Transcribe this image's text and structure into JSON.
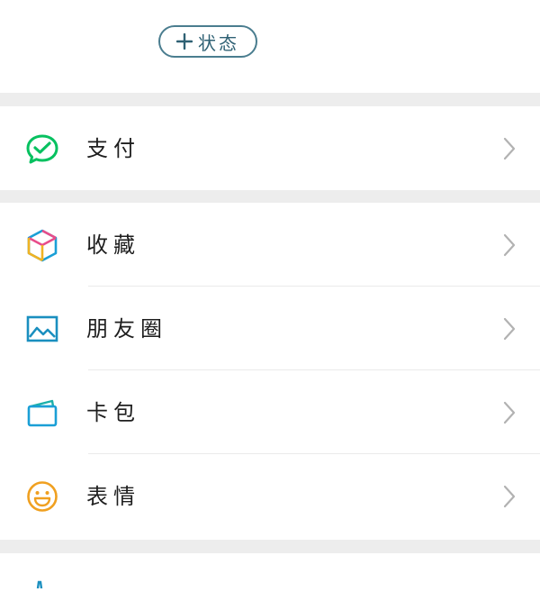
{
  "status_button": {
    "label": "状态",
    "icon": "plus-icon"
  },
  "sections": [
    {
      "items": [
        {
          "label": "支付",
          "icon": "wechat-pay-check-bubble-icon",
          "color": "#07c160"
        }
      ]
    },
    {
      "items": [
        {
          "label": "收藏",
          "icon": "favorites-cube-icon",
          "color": "#f0b323"
        },
        {
          "label": "朋友圈",
          "icon": "moments-picture-icon",
          "color": "#1a8fbf"
        },
        {
          "label": "卡包",
          "icon": "card-wallet-icon",
          "color": "#1ab0a9"
        },
        {
          "label": "表情",
          "icon": "emoji-smiley-icon",
          "color": "#f0a020"
        }
      ]
    }
  ],
  "colors": {
    "separator": "#ededed",
    "chevron": "#b2b2b2",
    "status_border": "#4a7d8f"
  }
}
